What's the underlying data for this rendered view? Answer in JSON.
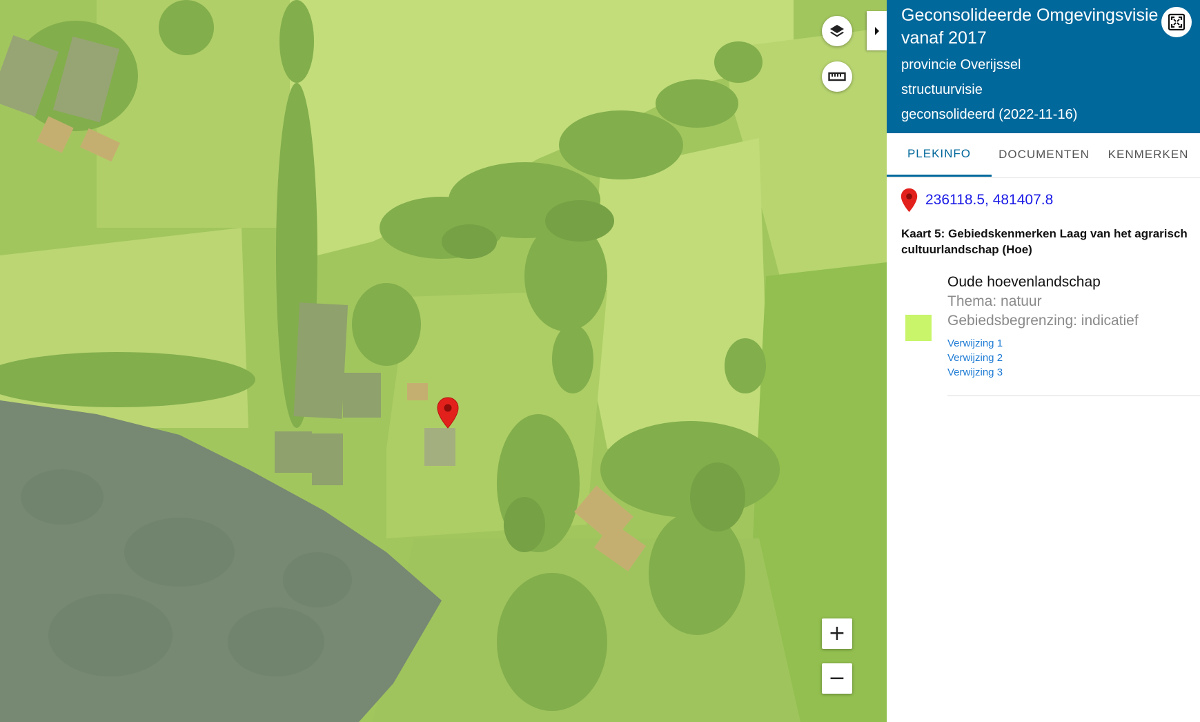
{
  "map": {
    "controls": {
      "layers_icon": "layers-icon",
      "measure_icon": "ruler-icon",
      "zoom_in_label": "+",
      "zoom_out_label": "−",
      "panel_toggle_icon": "caret-right-icon"
    },
    "marker_icon": "map-pin-icon"
  },
  "panel": {
    "title": "Geconsolideerde Omgevingsvisie vanaf 2017",
    "organisation": "provincie Overijssel",
    "type": "structuurvisie",
    "status": "geconsolideerd (2022-11-16)",
    "fullscreen_icon": "fullscreen-icon",
    "tabs": [
      {
        "label": "PLEKINFO",
        "active": true
      },
      {
        "label": "DOCUMENTEN",
        "active": false
      },
      {
        "label": "KENMERKEN",
        "active": false
      }
    ],
    "location": {
      "icon": "map-pin-icon",
      "coordinates": "236118.5, 481407.8"
    },
    "map_title": "Kaart 5: Gebiedskenmerken Laag van het agrarisch cultuurlandschap (Hoe)",
    "feature": {
      "name": "Oude hoevenlandschap",
      "theme": "Thema: natuur",
      "boundary": "Gebiedsbegrenzing: indicatief",
      "swatch_color": "#c8f56a",
      "references": [
        "Verwijzing 1",
        "Verwijzing 2",
        "Verwijzing 3"
      ]
    }
  },
  "colors": {
    "header_bg": "#01689b",
    "active_tab": "#01689b",
    "coordinate_link": "#1a1ae6",
    "reference_link": "#1e7bd4",
    "marker": "#e3211c"
  }
}
